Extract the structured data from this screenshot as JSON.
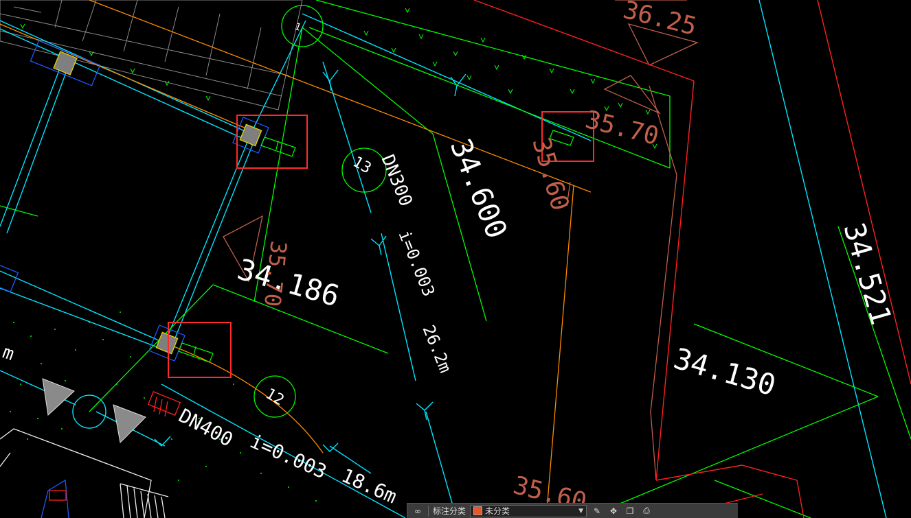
{
  "drawing": {
    "elevations": [
      "34.600",
      "34.186",
      "34.130",
      "34.521",
      "36.25",
      "35.70",
      "35.60",
      "35.60",
      "35.70"
    ],
    "pipes": [
      {
        "id": "13",
        "diameter": "DN300",
        "slope": "i=0.003",
        "length": "26.2m"
      },
      {
        "id": "12",
        "diameter": "DN400",
        "slope": "i=0.003",
        "length": "18.6m"
      }
    ],
    "partial_labels": [
      "1",
      "m"
    ]
  },
  "toolbar": {
    "label": "标注分类",
    "layer_name": "未分类",
    "layer_color": "#e8562a"
  },
  "colors": {
    "background": "#000000",
    "pipe": "#00e5ff",
    "boundary": "#00ff00",
    "road": "#ff2020",
    "highlight": "#ff2a2a",
    "elevation_text": "#ffffff",
    "old_elevation": "#c0604a",
    "orange_line": "#ff8c00"
  }
}
